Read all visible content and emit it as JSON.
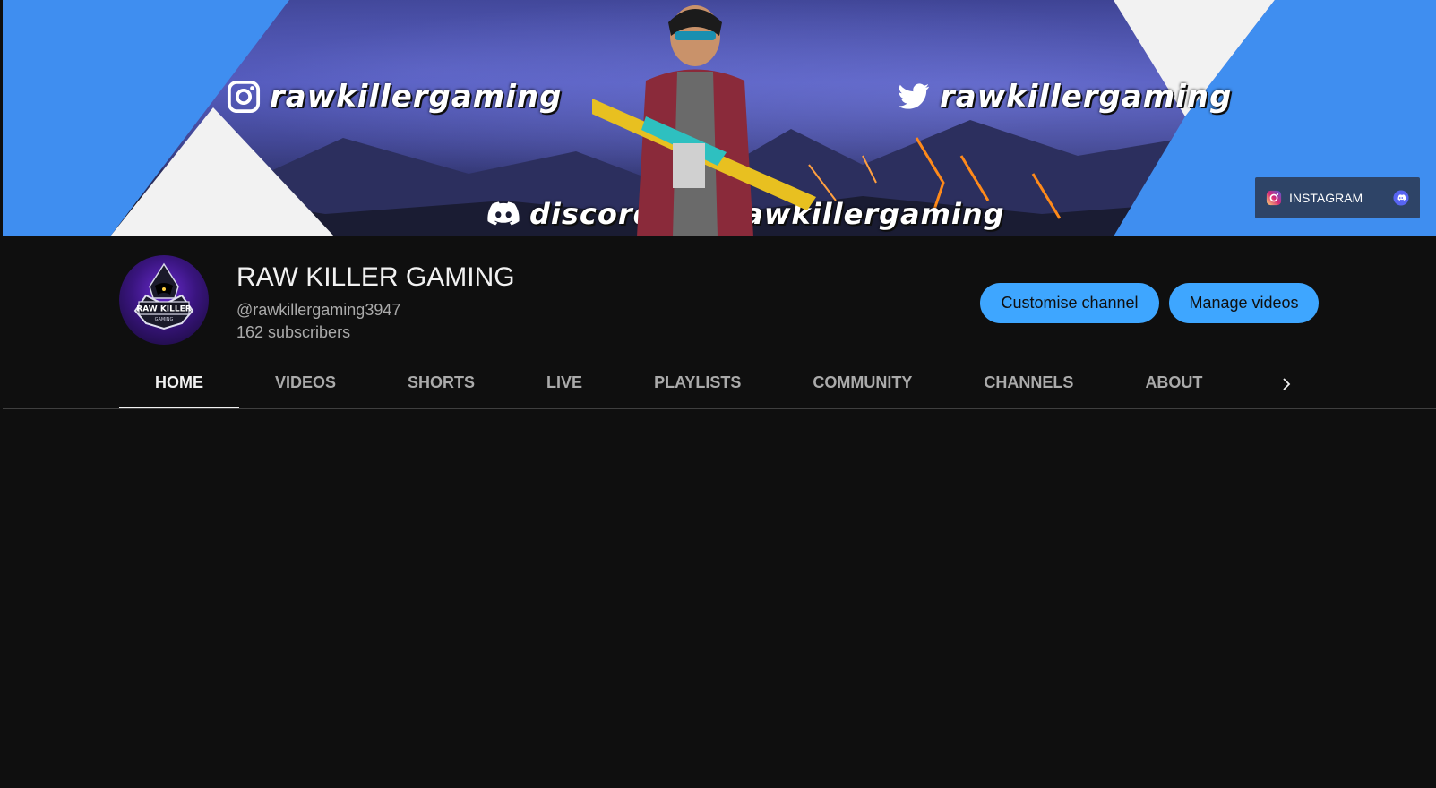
{
  "banner": {
    "instagram_handle": "rawkillergaming",
    "twitter_handle": "rawkillergaming",
    "discord_link": "discord.me/rawkillergaming",
    "link_chip": {
      "label": "INSTAGRAM",
      "icons": [
        "instagram-icon",
        "discord-icon"
      ]
    }
  },
  "channel": {
    "name": "RAW KILLER GAMING",
    "handle": "@rawkillergaming3947",
    "subscribers": "162 subscribers",
    "avatar_text_line1": "RAW KILLER",
    "avatar_text_line2": "GAMING"
  },
  "actions": {
    "customise_label": "Customise channel",
    "manage_label": "Manage videos"
  },
  "tabs": [
    {
      "label": "HOME",
      "active": true
    },
    {
      "label": "VIDEOS",
      "active": false
    },
    {
      "label": "SHORTS",
      "active": false
    },
    {
      "label": "LIVE",
      "active": false
    },
    {
      "label": "PLAYLISTS",
      "active": false
    },
    {
      "label": "COMMUNITY",
      "active": false
    },
    {
      "label": "CHANNELS",
      "active": false
    },
    {
      "label": "ABOUT",
      "active": false
    }
  ],
  "colors": {
    "background": "#0f0f0f",
    "accent_button": "#3ea6ff",
    "text_primary": "#f1f1f1",
    "text_secondary": "#aaaaaa",
    "banner_corner_blue": "#3f8ef0"
  }
}
